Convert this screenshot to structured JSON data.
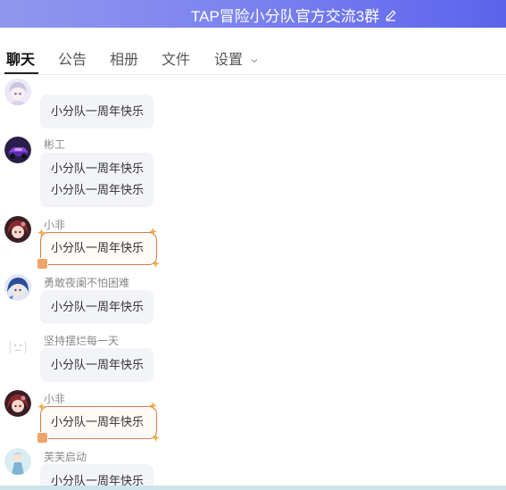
{
  "header": {
    "title": "TAP冒险小分队官方交流3群",
    "edit_icon": "edit-pencil-icon"
  },
  "tabs": [
    {
      "label": "聊天",
      "active": true
    },
    {
      "label": "公告"
    },
    {
      "label": "相册"
    },
    {
      "label": "文件"
    },
    {
      "label": "设置",
      "has_dropdown": true
    }
  ],
  "messages": [
    {
      "sender": "",
      "lines": [
        "小分队一周年快乐"
      ],
      "style": "plain",
      "avatar": "anime-girl-avatar"
    },
    {
      "sender": "彬工",
      "lines": [
        "小分队一周年快乐",
        "小分队一周年快乐"
      ],
      "style": "plain",
      "avatar": "race-car-avatar"
    },
    {
      "sender": "小非",
      "lines": [
        "小分队一周年快乐"
      ],
      "style": "decorated",
      "avatar": "red-hair-girl-avatar"
    },
    {
      "sender": "勇敢夜阑不怕困难",
      "lines": [
        "小分队一周年快乐"
      ],
      "style": "plain",
      "avatar": "blue-hair-avatar"
    },
    {
      "sender": "坚持摆烂每一天",
      "lines": [
        "小分队一周年快乐"
      ],
      "style": "plain",
      "avatar": "sketch-avatar"
    },
    {
      "sender": "小非",
      "lines": [
        "小分队一周年快乐"
      ],
      "style": "decorated",
      "avatar": "red-hair-girl-avatar"
    },
    {
      "sender": "芙芙启动",
      "lines": [
        "小分队一周年快乐"
      ],
      "style": "plain",
      "avatar": "blue-dress-avatar"
    }
  ],
  "colors": {
    "header_start": "#8f97ee",
    "header_end": "#5b63ec",
    "bubble_bg": "#f3f4f8",
    "decorated_border": "#d47b4f"
  }
}
